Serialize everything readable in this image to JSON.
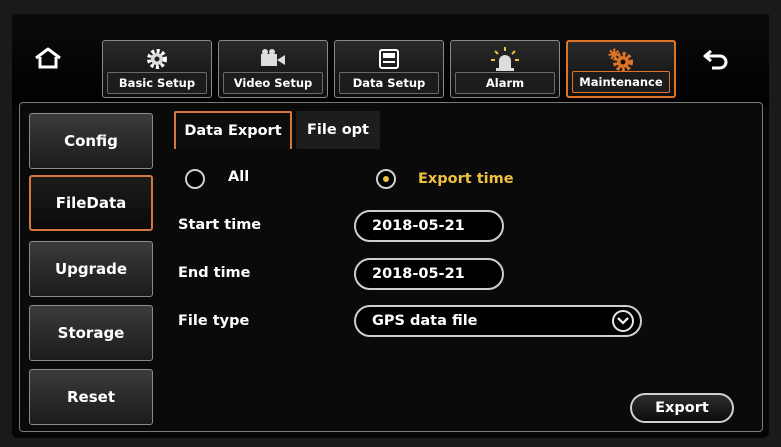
{
  "accent_color": "#e07426",
  "topbar": {
    "home_icon": "home-icon",
    "back_icon": "back-arrow-icon",
    "menu": [
      {
        "label": "Basic Setup",
        "icon": "gear-icon",
        "active": false
      },
      {
        "label": "Video Setup",
        "icon": "camera-icon",
        "active": false
      },
      {
        "label": "Data Setup",
        "icon": "storage-icon",
        "active": false
      },
      {
        "label": "Alarm",
        "icon": "alarm-light-icon",
        "active": false
      },
      {
        "label": "Maintenance",
        "icon": "gears-icon",
        "active": true
      }
    ]
  },
  "sidebar": {
    "items": [
      {
        "label": "Config",
        "active": false
      },
      {
        "label": "FileData",
        "active": true
      },
      {
        "label": "Upgrade",
        "active": false
      },
      {
        "label": "Storage",
        "active": false
      },
      {
        "label": "Reset",
        "active": false
      }
    ]
  },
  "tabs": [
    {
      "label": "Data Export",
      "active": true
    },
    {
      "label": "File opt",
      "active": false
    }
  ],
  "form": {
    "radio_all_label": "All",
    "radio_export_time_label": "Export time",
    "selected_radio": "Export time",
    "start_time_label": "Start time",
    "start_time_value": "2018-05-21",
    "end_time_label": "End time",
    "end_time_value": "2018-05-21",
    "file_type_label": "File type",
    "file_type_value": "GPS data file"
  },
  "actions": {
    "export_label": "Export"
  }
}
